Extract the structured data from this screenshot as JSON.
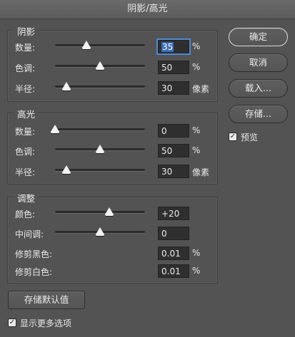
{
  "window": {
    "title": "阴影/高光"
  },
  "shadows": {
    "title": "阴影",
    "rows": [
      {
        "label": "数量:",
        "value": "35",
        "selected": "35",
        "unit": "%",
        "slider_fraction": 0.35
      },
      {
        "label": "色调:",
        "value": "50",
        "unit": "%",
        "slider_fraction": 0.5
      },
      {
        "label": "半径:",
        "value": "30",
        "unit": "像素",
        "slider_fraction": 0.13
      }
    ]
  },
  "highlights": {
    "title": "高光",
    "rows": [
      {
        "label": "数量:",
        "value": "0",
        "unit": "%",
        "slider_fraction": 0.0
      },
      {
        "label": "色调:",
        "value": "50",
        "unit": "%",
        "slider_fraction": 0.5
      },
      {
        "label": "半径:",
        "value": "30",
        "unit": "像素",
        "slider_fraction": 0.13
      }
    ]
  },
  "adjustments": {
    "title": "调整",
    "rows": [
      {
        "label": "颜色:",
        "value": "+20",
        "unit": "",
        "slider_fraction": 0.6
      },
      {
        "label": "中间调:",
        "value": "0",
        "unit": "",
        "slider_fraction": 0.5
      },
      {
        "label": "修剪黑色:",
        "value": "0.01",
        "unit": "%"
      },
      {
        "label": "修剪白色:",
        "value": "0.01",
        "unit": "%"
      }
    ]
  },
  "buttons": {
    "ok": "确定",
    "cancel": "取消",
    "load": "载入...",
    "save": "存储...",
    "save_defaults": "存储默认值"
  },
  "preview": {
    "label": "预览",
    "checked": true
  },
  "more_options": {
    "label": "显示更多选项",
    "checked": true
  }
}
